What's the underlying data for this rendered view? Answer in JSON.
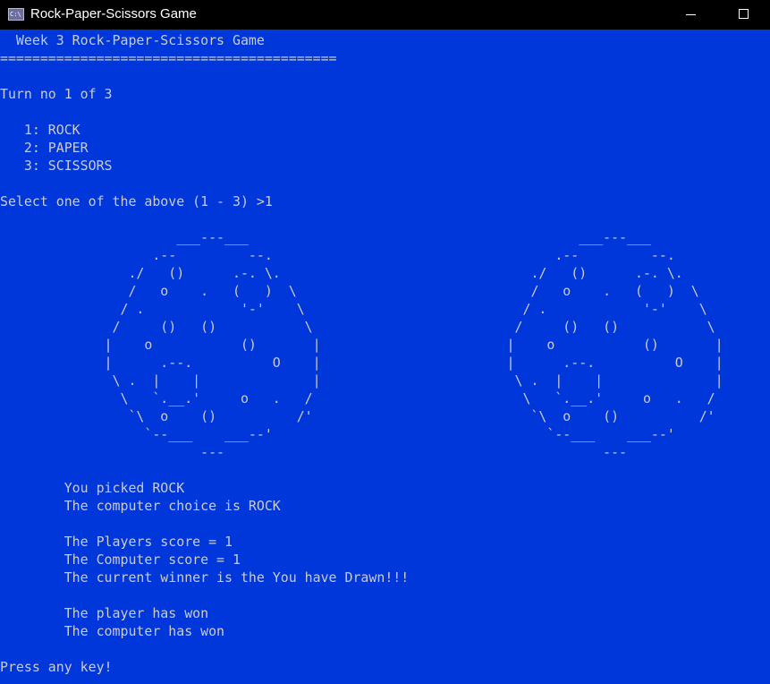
{
  "window": {
    "title": "Rock-Paper-Scissors Game",
    "icon_text": "C:\\"
  },
  "console": {
    "heading": "  Week 3 Rock-Paper-Scissors Game",
    "underline": "==========================================",
    "turn": "Turn no 1 of 3",
    "options": [
      "   1: ROCK",
      "   2: PAPER",
      "   3: SCISSORS"
    ],
    "prompt": "Select one of the above (1 - 3) >1",
    "player_pick": "        You picked ROCK",
    "computer_pick": "        The computer choice is ROCK",
    "player_score": "        The Players score = 1",
    "computer_score": "        The Computer score = 1",
    "current_winner": "        The current winner is the You have Drawn!!!",
    "player_won": "        The player has won",
    "computer_won": "        The computer has won",
    "press_key": "Press any key!"
  },
  "ascii_art": {
    "player_rock": "                      ___---___\n                   .--         --.\n                ./   ()      .-. \\.\n                /   o    .   (   )  \\\n               / .            '-'    \\\n              /     ()   ()           \\\n             |    o           ()       |\n             |      .--.          O    |\n              \\ .  |    |              |\n               \\   `.__.'     o   .   /\n                `\\  o    ()          /'\n                  `--___    ___--'\n                         ---",
    "computer_rock": "                      ___---___\n                   .--         --.\n                ./   ()      .-. \\.\n                /   o    .   (   )  \\\n               / .            '-'    \\\n              /     ()   ()           \\\n             |    o           ()       |\n             |      .--.          O    |\n              \\ .  |    |              |\n               \\   `.__.'     o   .   /\n                `\\  o    ()          /'\n                  `--___    ___--'\n                         ---"
  }
}
